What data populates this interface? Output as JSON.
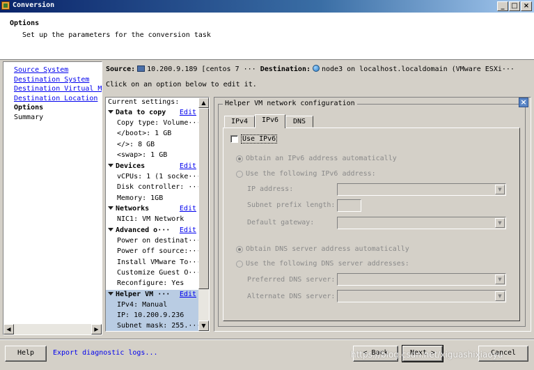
{
  "window": {
    "title": "Conversion"
  },
  "header": {
    "title": "Options",
    "subtitle": "Set up the parameters for the conversion task"
  },
  "nav": {
    "items": [
      {
        "label": "Source System",
        "type": "link"
      },
      {
        "label": "Destination System",
        "type": "link"
      },
      {
        "label": "Destination Virtual M",
        "type": "link"
      },
      {
        "label": "Destination Location",
        "type": "link"
      },
      {
        "label": "Options",
        "type": "current"
      },
      {
        "label": "Summary",
        "type": "plain"
      }
    ]
  },
  "source_line": {
    "source_label": "Source:",
    "source_value": "10.200.9.189 [centos 7 ···",
    "dest_label": "Destination:",
    "dest_value": "node3 on localhost.localdomain (VMware ESXi···"
  },
  "instruction": "Click on an option below to edit it.",
  "settings": {
    "header": "Current settings:",
    "edit_label": "Edit",
    "sections": [
      {
        "title": "Data to copy",
        "items": [
          "Copy type: Volume···",
          "</boot>: 1 GB",
          "</>: 8 GB",
          "<swap>: 1 GB"
        ]
      },
      {
        "title": "Devices",
        "items": [
          "vCPUs: 1 (1 socke···",
          "Disk controller: ···",
          "Memory: 1GB"
        ]
      },
      {
        "title": "Networks",
        "items": [
          "NIC1: VM Network"
        ]
      },
      {
        "title": "Advanced o···",
        "items": [
          "Power on destinat···",
          "Power off source:···",
          "Install VMware To···",
          "Customize Guest O···",
          "Reconfigure: Yes"
        ]
      },
      {
        "title": "Helper VM ···",
        "items": [
          "IPv4: Manual",
          "IP: 10.200.9.236",
          "Subnet mask: 255.···"
        ]
      }
    ]
  },
  "panel": {
    "group_title": "Helper VM network configuration",
    "tabs": [
      "IPv4",
      "IPv6",
      "DNS"
    ],
    "active_tab": "IPv6",
    "use_ipv6_label": "Use IPv6",
    "use_ipv6_checked": false,
    "radio_auto_ip": "Obtain an IPv6 address automatically",
    "radio_manual_ip": "Use the following IPv6 address:",
    "ip_label": "IP address:",
    "prefix_label": "Subnet prefix length:",
    "gateway_label": "Default gateway:",
    "radio_auto_dns": "Obtain DNS server address automatically",
    "radio_manual_dns": "Use the following DNS server addresses:",
    "pref_dns_label": "Preferred DNS server:",
    "alt_dns_label": "Alternate DNS server:"
  },
  "footer": {
    "help": "Help",
    "export": "Export diagnostic logs...",
    "back": "< Back",
    "next": "Next >",
    "cancel": "Cancel"
  },
  "watermark": "https://blog.csdn.net/xiguashixiaoyu",
  "colors": {
    "title_bar": "#0a246a",
    "link": "#0000ee",
    "selection": "#b9cce3",
    "face": "#d4d0c8"
  }
}
